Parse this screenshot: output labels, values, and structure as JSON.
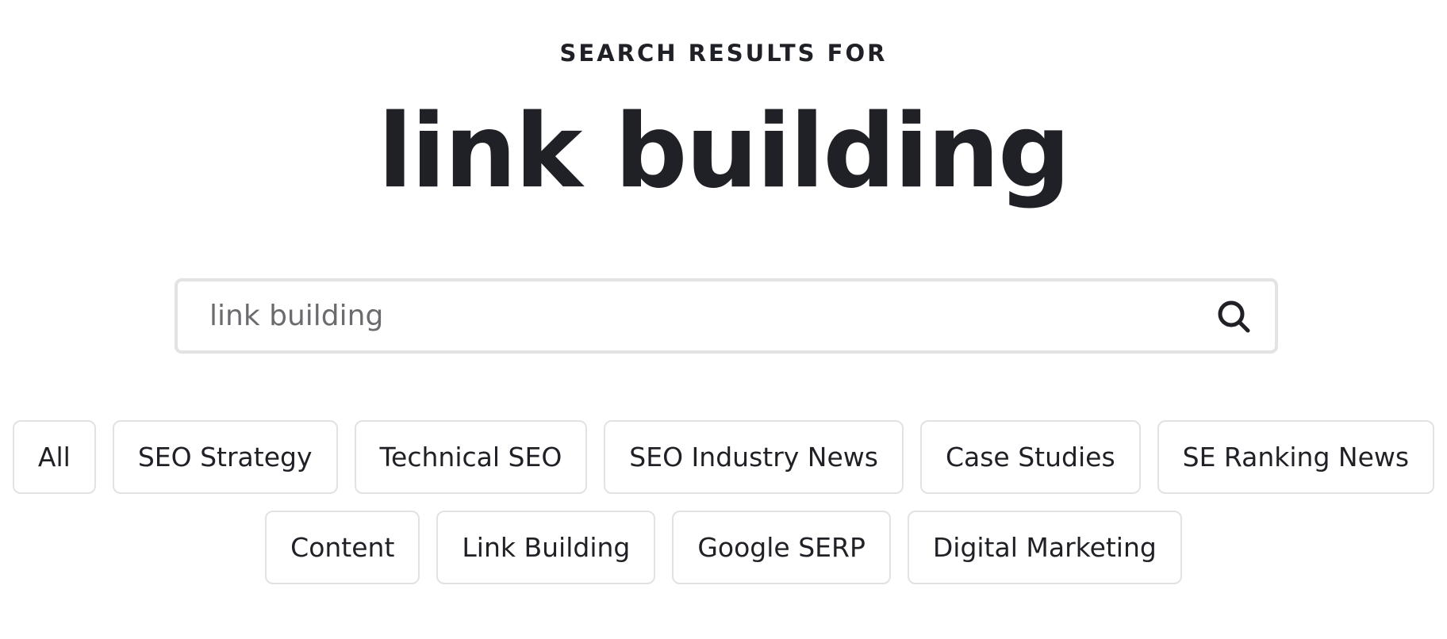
{
  "header": {
    "eyebrow": "SEARCH RESULTS FOR",
    "query_title": "link building"
  },
  "search": {
    "value": "link building",
    "button_icon": "search-icon"
  },
  "categories": {
    "row1": [
      "All",
      "SEO Strategy",
      "Technical SEO",
      "SEO Industry News",
      "Case Studies",
      "SE Ranking News"
    ],
    "row2": [
      "Content",
      "Link Building",
      "Google SERP",
      "Digital Marketing"
    ]
  },
  "colors": {
    "text": "#202126",
    "muted_text": "#6b6b6f",
    "border": "#e3e3e3"
  }
}
